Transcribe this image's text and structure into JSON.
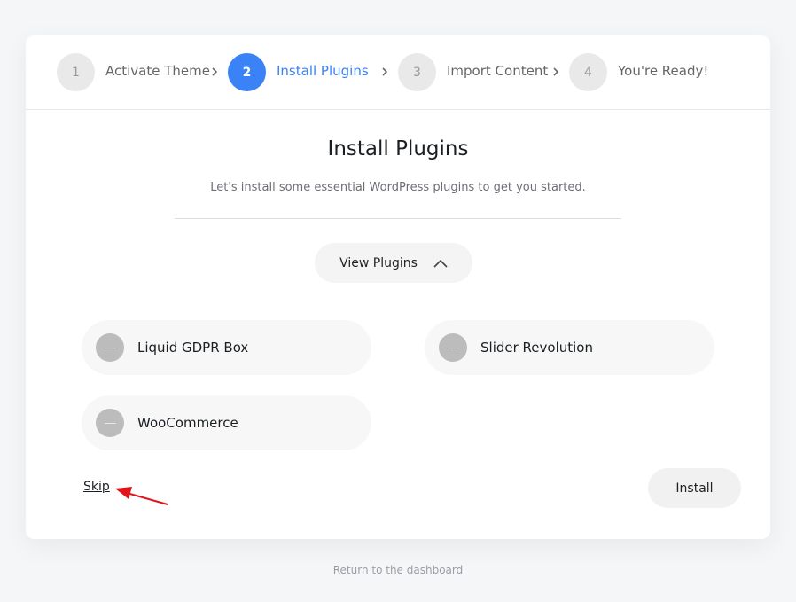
{
  "steps": [
    {
      "number": "1",
      "label": "Activate Theme",
      "active": false
    },
    {
      "number": "2",
      "label": "Install Plugins",
      "active": true
    },
    {
      "number": "3",
      "label": "Import Content",
      "active": false
    },
    {
      "number": "4",
      "label": "You're Ready!",
      "active": false
    }
  ],
  "main": {
    "title": "Install Plugins",
    "subtitle": "Let's install some essential WordPress plugins to get you started.",
    "view_plugins_label": "View Plugins",
    "view_plugins_icon": "chevron-up-icon",
    "plugins": [
      {
        "name": "Liquid GDPR Box"
      },
      {
        "name": "Slider Revolution"
      },
      {
        "name": "WooCommerce"
      }
    ],
    "skip_label": "Skip",
    "install_label": "Install"
  },
  "footer": {
    "return_link": "Return to the dashboard"
  },
  "colors": {
    "accent": "#3b82f6",
    "annotation_arrow": "#e0161b",
    "background": "#f5f6f8"
  }
}
